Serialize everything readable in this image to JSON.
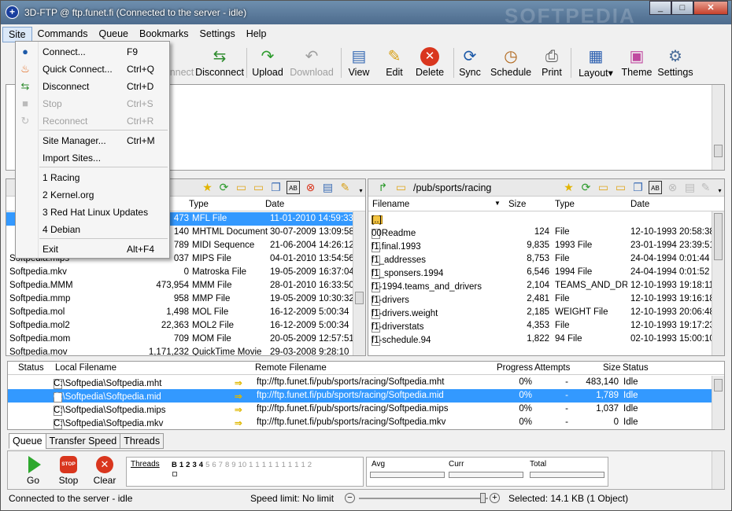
{
  "window": {
    "title": "3D-FTP @ ftp.funet.fi (Connected to the server - idle)",
    "watermark": "SOFTPEDIA",
    "min": "_",
    "max": "□",
    "close": "✕"
  },
  "menubar": [
    "Site",
    "Commands",
    "Queue",
    "Bookmarks",
    "Settings",
    "Help"
  ],
  "toolbar": {
    "connect": "Connect",
    "disconnect": "Disconnect",
    "upload": "Upload",
    "download": "Download",
    "view": "View",
    "edit": "Edit",
    "delete": "Delete",
    "sync": "Sync",
    "schedule": "Schedule",
    "print": "Print",
    "layout": "Layout",
    "layout_arrow": "▾",
    "theme": "Theme",
    "settings": "Settings"
  },
  "site_menu": {
    "items": [
      {
        "label": "Connect...",
        "shortcut": "F9",
        "icon": "globe-icon",
        "enabled": true
      },
      {
        "label": "Quick Connect...",
        "shortcut": "Ctrl+Q",
        "icon": "flame-icon",
        "enabled": true
      },
      {
        "label": "Disconnect",
        "shortcut": "Ctrl+D",
        "icon": "disconnect-icon",
        "enabled": true
      },
      {
        "label": "Stop",
        "shortcut": "Ctrl+S",
        "icon": "stop-icon",
        "enabled": false
      },
      {
        "label": "Reconnect",
        "shortcut": "Ctrl+R",
        "icon": "reconnect-icon",
        "enabled": false
      },
      {
        "label": "Site Manager...",
        "shortcut": "Ctrl+M",
        "enabled": true
      },
      {
        "label": "Import Sites...",
        "shortcut": "",
        "enabled": true
      },
      {
        "label": "1 Racing",
        "shortcut": "",
        "enabled": true
      },
      {
        "label": "2 Kernel.org",
        "shortcut": "",
        "enabled": true
      },
      {
        "label": "3 Red Hat Linux Updates",
        "shortcut": "",
        "enabled": true
      },
      {
        "label": "4 Debian",
        "shortcut": "",
        "enabled": true
      },
      {
        "label": "Exit",
        "shortcut": "Alt+F4",
        "enabled": true
      }
    ]
  },
  "local_pane": {
    "columns": [
      "Type",
      "Date"
    ],
    "rows": [
      {
        "name": "",
        "size": "473",
        "type": "MFL File",
        "date": "11-01-2010 14:59:33",
        "selected": true
      },
      {
        "name": "",
        "size": "140",
        "type": "MHTML Document",
        "date": "30-07-2009 13:09:58"
      },
      {
        "name": "",
        "size": "789",
        "type": "MIDI Sequence",
        "date": "21-06-2004 14:26:12"
      },
      {
        "name": "Softpedia.mips",
        "size": "037",
        "type": "MIPS File",
        "date": "04-01-2010 13:54:56"
      },
      {
        "name": "Softpedia.mkv",
        "size": "0",
        "type": "Matroska File",
        "date": "19-05-2009 16:37:04"
      },
      {
        "name": "Softpedia.MMM",
        "size": "473,954",
        "type": "MMM File",
        "date": "28-01-2010 16:33:50"
      },
      {
        "name": "Softpedia.mmp",
        "size": "958",
        "type": "MMP File",
        "date": "19-05-2009 10:30:32"
      },
      {
        "name": "Softpedia.mol",
        "size": "1,498",
        "type": "MOL File",
        "date": "16-12-2009 5:00:34"
      },
      {
        "name": "Softpedia.mol2",
        "size": "22,363",
        "type": "MOL2 File",
        "date": "16-12-2009 5:00:34"
      },
      {
        "name": "Softpedia.mom",
        "size": "709",
        "type": "MOM File",
        "date": "20-05-2009 12:57:51"
      },
      {
        "name": "Softpedia.mov",
        "size": "1,171,232",
        "type": "QuickTime Movie",
        "date": "29-03-2008 9:28:10"
      }
    ]
  },
  "remote_pane": {
    "path": "/pub/sports/racing",
    "columns": [
      "Filename",
      "Size",
      "Type",
      "Date"
    ],
    "rows": [
      {
        "name": "[..]",
        "size": "",
        "type": "",
        "date": "",
        "folder": true
      },
      {
        "name": "00Readme",
        "size": "124",
        "type": "File",
        "date": "12-10-1993 20:58:38"
      },
      {
        "name": "f1.final.1993",
        "size": "9,835",
        "type": "1993 File",
        "date": "23-01-1994 23:39:51"
      },
      {
        "name": "f1_addresses",
        "size": "8,753",
        "type": "File",
        "date": "24-04-1994 0:01:44"
      },
      {
        "name": "f1_sponsers.1994",
        "size": "6,546",
        "type": "1994 File",
        "date": "24-04-1994 0:01:52"
      },
      {
        "name": "f1-1994.teams_and_drivers",
        "size": "2,104",
        "type": "TEAMS_AND_DRIV",
        "date": "12-10-1993 19:18:11"
      },
      {
        "name": "f1-drivers",
        "size": "2,481",
        "type": "File",
        "date": "12-10-1993 19:16:18"
      },
      {
        "name": "f1-drivers.weight",
        "size": "2,185",
        "type": "WEIGHT File",
        "date": "12-10-1993 20:06:48"
      },
      {
        "name": "f1-driverstats",
        "size": "4,353",
        "type": "File",
        "date": "12-10-1993 19:17:23"
      },
      {
        "name": "f1-schedule.94",
        "size": "1,822",
        "type": "94 File",
        "date": "02-10-1993 15:00:10"
      }
    ]
  },
  "queue": {
    "columns": [
      "Status",
      "Local Filename",
      "Remote Filename",
      "Progress",
      "Attempts",
      "Size",
      "Status"
    ],
    "rows": [
      {
        "local": "C:\\Softpedia\\Softpedia.mht",
        "remote": "ftp://ftp.funet.fi/pub/sports/racing/Softpedia.mht",
        "progress": "0%",
        "attempts": "-",
        "size": "483,140",
        "status": "Idle"
      },
      {
        "local": "C:\\Softpedia\\Softpedia.mid",
        "remote": "ftp://ftp.funet.fi/pub/sports/racing/Softpedia.mid",
        "progress": "0%",
        "attempts": "-",
        "size": "1,789",
        "status": "Idle",
        "selected": true
      },
      {
        "local": "C:\\Softpedia\\Softpedia.mips",
        "remote": "ftp://ftp.funet.fi/pub/sports/racing/Softpedia.mips",
        "progress": "0%",
        "attempts": "-",
        "size": "1,037",
        "status": "Idle"
      },
      {
        "local": "C:\\Softpedia\\Softpedia.mkv",
        "remote": "ftp://ftp.funet.fi/pub/sports/racing/Softpedia.mkv",
        "progress": "0%",
        "attempts": "-",
        "size": "0",
        "status": "Idle"
      }
    ]
  },
  "tabs": [
    "Queue",
    "Transfer Speed",
    "Threads"
  ],
  "controls": {
    "go": "Go",
    "stop": "Stop",
    "clear": "Clear",
    "stop_badge": "STOP"
  },
  "threads": {
    "label": "Threads",
    "items": [
      "B",
      "1",
      "2",
      "3",
      "4",
      "5",
      "6",
      "7",
      "8",
      "9",
      "10",
      "1",
      "1",
      "1",
      "1",
      "1",
      "1",
      "1",
      "1",
      "1",
      "2"
    ]
  },
  "speeds": {
    "avg": "Avg",
    "curr": "Curr",
    "total": "Total"
  },
  "statusbar": {
    "left": "Connected to the server - idle",
    "speed_limit": "Speed limit: No limit",
    "selected": "Selected: 14.1 KB (1 Object)",
    "minus": "−",
    "plus": "+"
  },
  "colors": {
    "selection": "#3399ff",
    "titlebar": "#4d6b8d"
  }
}
